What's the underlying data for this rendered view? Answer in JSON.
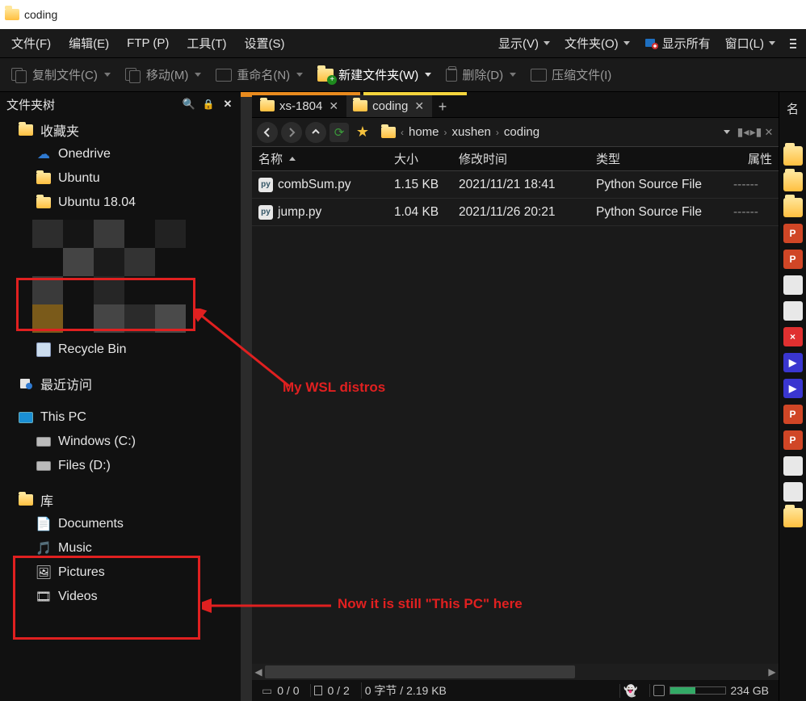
{
  "window": {
    "title": "coding"
  },
  "menu": {
    "items": [
      "文件(F)",
      "编辑(E)",
      "FTP (P)",
      "工具(T)",
      "设置(S)"
    ],
    "right": {
      "view": "显示(V)",
      "folders": "文件夹(O)",
      "show_all": "显示所有",
      "window": "窗口(L)"
    }
  },
  "toolbar": {
    "copy": "复制文件(C)",
    "move": "移动(M)",
    "rename": "重命名(N)",
    "new_folder": "新建文件夹(W)",
    "delete": "删除(D)",
    "compress": "压缩文件(I)"
  },
  "sidebar": {
    "title": "文件夹树",
    "favorites": "收藏夹",
    "items_fav": [
      {
        "label": "Onedrive",
        "icon": "onedrive"
      },
      {
        "label": "Ubuntu",
        "icon": "folder"
      },
      {
        "label": "Ubuntu 18.04",
        "icon": "folder"
      }
    ],
    "recycle": "Recycle Bin",
    "recent": "最近访问",
    "this_pc": "This PC",
    "items_drives": [
      {
        "label": "Windows (C:)",
        "icon": "drive"
      },
      {
        "label": "Files (D:)",
        "icon": "drive"
      }
    ],
    "libraries": "库",
    "items_libs": [
      {
        "label": "Documents",
        "icon": "doc"
      },
      {
        "label": "Music",
        "icon": "music"
      },
      {
        "label": "Pictures",
        "icon": "pic"
      },
      {
        "label": "Videos",
        "icon": "vid"
      }
    ]
  },
  "tabs": {
    "t0": "xs-1804",
    "t1": "coding"
  },
  "breadcrumb": {
    "seg0": "home",
    "seg1": "xushen",
    "seg2": "coding"
  },
  "columns": {
    "name": "名称",
    "size": "大小",
    "time": "修改时间",
    "type": "类型",
    "attr": "属性"
  },
  "files": [
    {
      "name": "combSum.py",
      "size": "1.15 KB",
      "time": "2021/11/21 18:41",
      "type": "Python Source File",
      "attr": "------"
    },
    {
      "name": "jump.py",
      "size": "1.04 KB",
      "time": "2021/11/26 20:21",
      "type": "Python Source File",
      "attr": "------"
    }
  ],
  "status": {
    "sel": "0 / 0",
    "files": "0 / 2",
    "bytes": "0 字节 / 2.19 KB",
    "disk": "234 GB"
  },
  "right_strip": {
    "header": "名"
  },
  "annotations": {
    "a": "My WSL distros",
    "b": "Now it is still \"This PC\" here"
  }
}
